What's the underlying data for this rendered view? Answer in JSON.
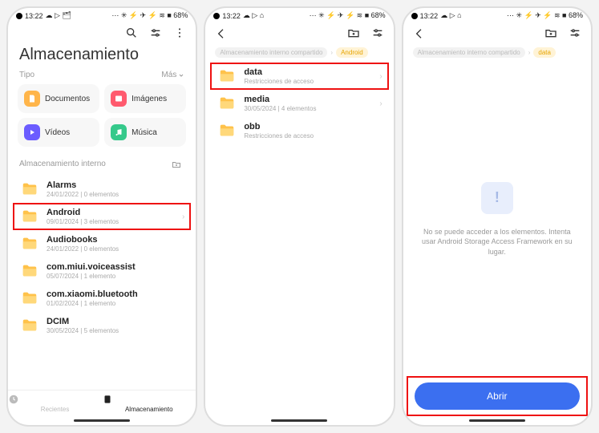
{
  "statusbar": {
    "time": "13:22",
    "left_icons": "☁ ▷ 🗂",
    "left_icons_alt": "☁ ▷ ⌂",
    "right_icons": "⋯ ✳ ⚡ ✈ ⚡ ≋ ■ 68%",
    "battery": "68%"
  },
  "screen1": {
    "title": "Almacenamiento",
    "tipo_label": "Tipo",
    "mas_label": "Más",
    "categories": [
      {
        "label": "Documentos",
        "color": "#ffb54a"
      },
      {
        "label": "Imágenes",
        "color": "#ff5a6e"
      },
      {
        "label": "Vídeos",
        "color": "#6b5cff"
      },
      {
        "label": "Música",
        "color": "#35c98b"
      }
    ],
    "section_header": "Almacenamiento interno",
    "folders": [
      {
        "name": "Alarms",
        "sub": "24/01/2022 | 0 elementos",
        "hl": false,
        "chev": false
      },
      {
        "name": "Android",
        "sub": "09/01/2024 | 3 elementos",
        "hl": true,
        "chev": true
      },
      {
        "name": "Audiobooks",
        "sub": "24/01/2022 | 0 elementos",
        "hl": false,
        "chev": false
      },
      {
        "name": "com.miui.voiceassist",
        "sub": "05/07/2024 | 1 elemento",
        "hl": false,
        "chev": false
      },
      {
        "name": "com.xiaomi.bluetooth",
        "sub": "01/02/2024 | 1 elemento",
        "hl": false,
        "chev": false
      },
      {
        "name": "DCIM",
        "sub": "30/05/2024 | 5 elementos",
        "hl": false,
        "chev": false
      }
    ],
    "bottom_nav": {
      "recientes": "Recientes",
      "almacenamiento": "Almacenamiento"
    }
  },
  "screen2": {
    "breadcrumb": [
      {
        "label": "Almacenamiento interno compartido",
        "active": false
      },
      {
        "label": "Android",
        "active": true
      }
    ],
    "folders": [
      {
        "name": "data",
        "sub": "Restricciones de acceso",
        "hl": true,
        "chev": true
      },
      {
        "name": "media",
        "sub": "30/05/2024 | 4 elementos",
        "hl": false,
        "chev": true
      },
      {
        "name": "obb",
        "sub": "Restricciones de acceso",
        "hl": false,
        "chev": false
      }
    ]
  },
  "screen3": {
    "breadcrumb": [
      {
        "label": "Almacenamiento interno compartido",
        "active": false
      },
      {
        "label": "data",
        "active": true
      }
    ],
    "empty_text": "No se puede acceder a los elementos. Intenta usar Android Storage Access Framework en su lugar.",
    "open_button": "Abrir"
  }
}
